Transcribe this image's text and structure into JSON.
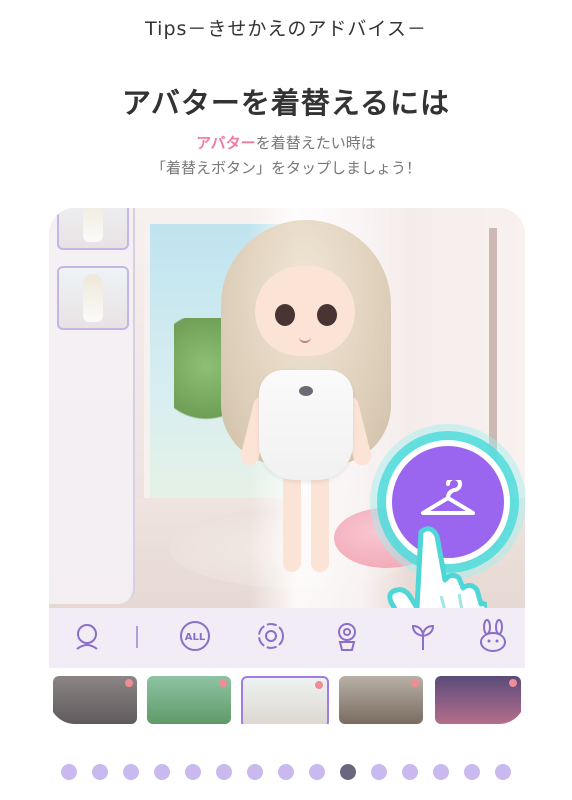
{
  "header": {
    "title": "Tips－きせかえのアドバイス－"
  },
  "main": {
    "heading": "アバターを着替えるには",
    "desc_highlight": "アバター",
    "desc_line1_rest": "を着替えたい時は",
    "desc_line2": "「着替えボタン」をタップしましょう！"
  },
  "app": {
    "toolbar": [
      "avatar-face-icon",
      "all-icon",
      "flower-outline-icon",
      "flower-pot-icon",
      "plant-icon",
      "bunny-icon"
    ],
    "toolbar_all_label": "ALL",
    "change_button_icon": "hanger-icon",
    "thumbnails": [
      "room-dark",
      "garden",
      "white-room",
      "house-exterior",
      "night-city"
    ],
    "selected_thumbnail": 2
  },
  "pagination": {
    "total": 15,
    "active_index": 9
  },
  "colors": {
    "accent": "#9a66f0",
    "highlight": "#f07aa6",
    "dot": "#c9b9ef",
    "dot_active": "#6a6680"
  }
}
